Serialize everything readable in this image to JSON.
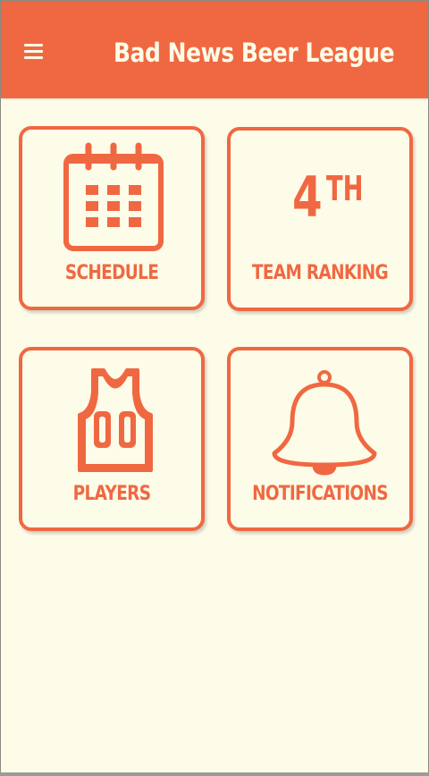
{
  "appbar": {
    "title": "Bad News Beer League",
    "menu_icon": "hamburger-menu-icon"
  },
  "colors": {
    "accent": "#f06842",
    "background": "#fdfce8"
  },
  "tiles": [
    {
      "label": "SCHEDULE",
      "icon": "calendar-icon"
    },
    {
      "label": "TEAM RANKING",
      "rank_number": "4",
      "rank_suffix": "TH"
    },
    {
      "label": "PLAYERS",
      "icon": "jersey-icon",
      "jersey_number": "00"
    },
    {
      "label": "NOTIFICATIONS",
      "icon": "bell-icon"
    }
  ]
}
